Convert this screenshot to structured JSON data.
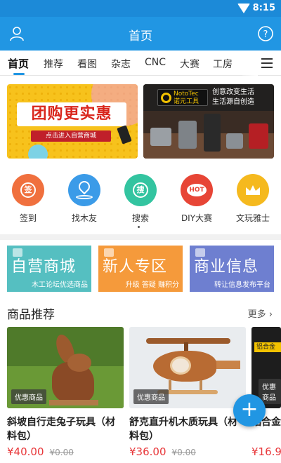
{
  "status_bar": {
    "time": "8:15",
    "wifi_icon": "wifi-icon"
  },
  "app_bar": {
    "title": "首页",
    "left_icon": "user-icon",
    "right_icon": "help-icon"
  },
  "tabs": [
    {
      "label": "首页",
      "active": true
    },
    {
      "label": "推荐"
    },
    {
      "label": "看图"
    },
    {
      "label": "杂志"
    },
    {
      "label": "CNC"
    },
    {
      "label": "大赛"
    },
    {
      "label": "工房"
    }
  ],
  "banners": {
    "left": {
      "headline": "团购更实惠",
      "cta": "点击进入自营商城"
    },
    "right": {
      "brand": "NotoTec",
      "brand_cn": "诺元工具",
      "slogan_1": "创意改变生活",
      "slogan_2": "生活源自创造"
    }
  },
  "quick_actions": [
    {
      "label": "签到",
      "icon": "sign-in-icon",
      "glyph": "签",
      "color": "#f0703e"
    },
    {
      "label": "找木友",
      "icon": "location-pin-icon",
      "color": "#3b9be8"
    },
    {
      "label": "搜索",
      "icon": "search-icon",
      "glyph": "搜",
      "color": "#33c4a0"
    },
    {
      "label": "DIY大赛",
      "icon": "hot-icon",
      "glyph": "HOT",
      "color": "#e74536"
    },
    {
      "label": "文玩雅士",
      "icon": "crown-icon",
      "color": "#f5b91e"
    }
  ],
  "tiles": [
    {
      "title": "自营商城",
      "subtitle": "木工论坛优选商品",
      "color": "#55bfc1"
    },
    {
      "title": "新人专区",
      "subtitle": "升级 答疑 赚积分",
      "color": "#f59a3b"
    },
    {
      "title": "商业信息",
      "subtitle": "转让信息发布平台",
      "color": "#6e7fd0"
    }
  ],
  "recommend": {
    "title": "商品推荐",
    "more": "更多",
    "products": [
      {
        "badge": "优惠商品",
        "name": "斜坡自行走兔子玩具（材料包）",
        "price": "¥40.00",
        "old_price": "¥0.00"
      },
      {
        "badge": "优惠商品",
        "name": "舒克直升机木质玩具（材料包）",
        "price": "¥36.00",
        "old_price": "¥0.00"
      },
      {
        "badge": "优惠商品",
        "tag": "铝合金",
        "name": "铝合金角度尺",
        "price": "¥16.9"
      }
    ]
  },
  "fab": {
    "label": "+"
  }
}
